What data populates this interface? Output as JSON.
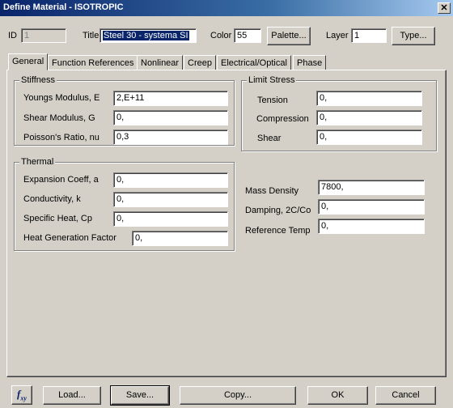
{
  "window": {
    "title": "Define Material - ISOTROPIC"
  },
  "header": {
    "id_label": "ID",
    "id_value": "1",
    "title_label": "Title",
    "title_value": "Steel 30 - systema SI",
    "color_label": "Color",
    "color_value": "55",
    "palette_button": "Palette...",
    "layer_label": "Layer",
    "layer_value": "1",
    "type_button": "Type..."
  },
  "tabs": [
    "General",
    "Function References",
    "Nonlinear",
    "Creep",
    "Electrical/Optical",
    "Phase"
  ],
  "stiffness": {
    "title": "Stiffness",
    "youngs_label": "Youngs Modulus, E",
    "youngs_value": "2,E+11",
    "shear_label": "Shear Modulus, G",
    "shear_value": "0,",
    "poisson_label": "Poisson's Ratio, nu",
    "poisson_value": "0,3"
  },
  "limit_stress": {
    "title": "Limit Stress",
    "tension_label": "Tension",
    "tension_value": "0,",
    "compression_label": "Compression",
    "compression_value": "0,",
    "shear_label": "Shear",
    "shear_value": "0,"
  },
  "thermal": {
    "title": "Thermal",
    "expansion_label": "Expansion Coeff, a",
    "expansion_value": "0,",
    "conductivity_label": "Conductivity, k",
    "conductivity_value": "0,",
    "specific_heat_label": "Specific Heat, Cp",
    "specific_heat_value": "0,",
    "heat_gen_label": "Heat Generation Factor",
    "heat_gen_value": "0,"
  },
  "other": {
    "mass_density_label": "Mass Density",
    "mass_density_value": "7800,",
    "damping_label": "Damping, 2C/Co",
    "damping_value": "0,",
    "ref_temp_label": "Reference Temp",
    "ref_temp_value": "0,"
  },
  "footer": {
    "fxy_icon": "f",
    "fxy_sub": "xy",
    "load_button": "Load...",
    "save_button": "Save...",
    "copy_button": "Copy...",
    "ok_button": "OK",
    "cancel_button": "Cancel"
  }
}
